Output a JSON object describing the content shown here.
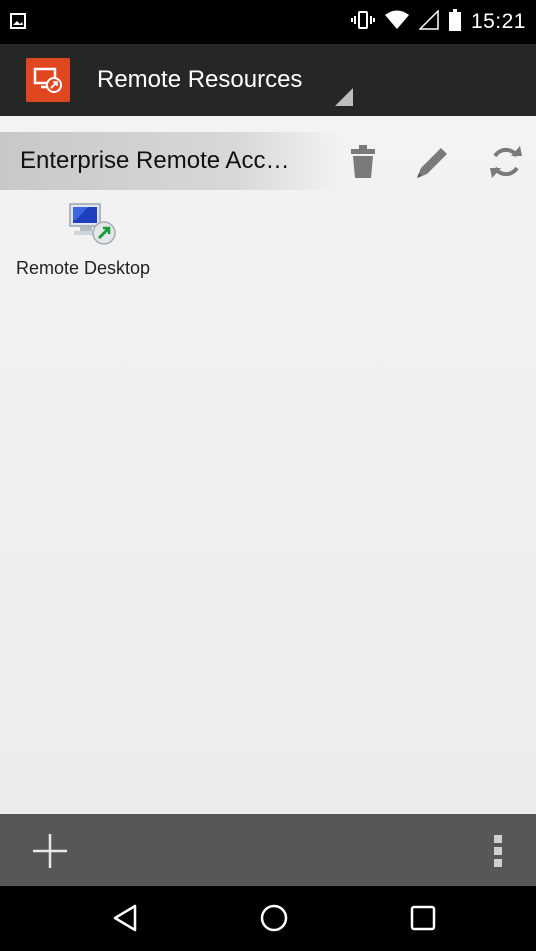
{
  "status_bar": {
    "time": "15:21",
    "icons": [
      "image-notification-icon",
      "vibrate-icon",
      "wifi-icon",
      "cell-signal-icon",
      "battery-icon"
    ]
  },
  "action_bar": {
    "title": "Remote Resources",
    "logo_icon": "remote-desktop-logo-icon",
    "accent_color": "#e0461f"
  },
  "group": {
    "title": "Enterprise Remote Acc…",
    "actions": [
      "delete-icon",
      "edit-icon",
      "refresh-icon"
    ]
  },
  "resources": [
    {
      "label": "Remote Desktop",
      "icon": "remote-desktop-icon"
    }
  ],
  "bottom_bar": {
    "actions": [
      "add-icon",
      "overflow-menu-icon"
    ]
  },
  "nav_bar": {
    "buttons": [
      "back-icon",
      "home-icon",
      "recents-icon"
    ]
  }
}
